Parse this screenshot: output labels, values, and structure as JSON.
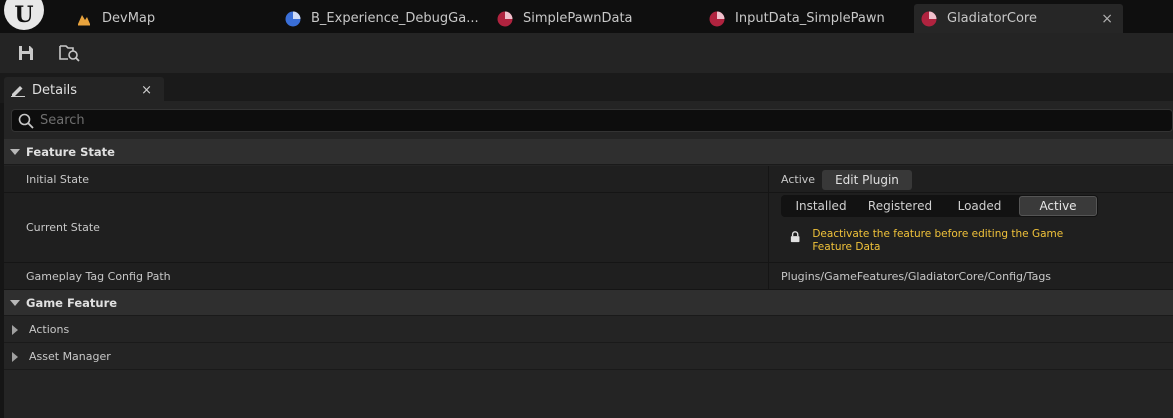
{
  "tabs": [
    {
      "label": "DevMap",
      "icon": "level-map-icon",
      "color": "#e8a33d"
    },
    {
      "label": "B_Experience_DebugGa...",
      "icon": "blueprint-data-icon",
      "color": "#3a6fd8"
    },
    {
      "label": "SimplePawnData",
      "icon": "data-asset-icon",
      "color": "#b0233f"
    },
    {
      "label": "InputData_SimplePawn",
      "icon": "data-asset-icon",
      "color": "#b0233f"
    },
    {
      "label": "GladiatorCore",
      "icon": "data-asset-icon",
      "color": "#b0233f",
      "active": true
    }
  ],
  "toolbar": {
    "save_icon": "save-icon",
    "browse_icon": "browse-asset-icon"
  },
  "details": {
    "tab_label": "Details",
    "close_glyph": "×",
    "search_placeholder": "Search"
  },
  "feature_state": {
    "header": "Feature State",
    "initial_state_label": "Initial State",
    "initial_state_value": "Active",
    "edit_plugin_label": "Edit Plugin",
    "current_state_label": "Current State",
    "states": [
      "Installed",
      "Registered",
      "Loaded",
      "Active"
    ],
    "selected_state": "Active",
    "warning_text": "Deactivate the feature before editing the Game Feature Data",
    "tag_config_label": "Gameplay Tag Config Path",
    "tag_config_value": "Plugins/GameFeatures/GladiatorCore/Config/Tags"
  },
  "game_feature": {
    "header": "Game Feature",
    "items": [
      "Actions",
      "Asset Manager"
    ]
  },
  "colors": {
    "warning": "#f0c23a",
    "panel_bg": "#242424",
    "accent_data_asset": "#b0233f"
  }
}
